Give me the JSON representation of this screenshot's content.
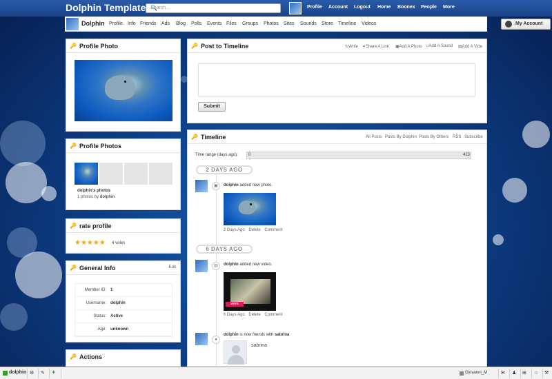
{
  "header": {
    "site_title": "Dolphin Template",
    "search_placeholder": "Search...",
    "nav": [
      "Profile",
      "Account",
      "Logout",
      "Home",
      "Boonex",
      "People",
      "More"
    ]
  },
  "profile_bar": {
    "name": "Dolphin",
    "nav": [
      "Profile",
      "Info",
      "Friends",
      "Ads",
      "Blog",
      "Polls",
      "Events",
      "Files",
      "Groups",
      "Photos",
      "Sites",
      "Sounds",
      "Store",
      "Timeline",
      "Videos"
    ],
    "my_account": "My Account"
  },
  "profile_photo": {
    "title": "Profile Photo"
  },
  "profile_photos": {
    "title": "Profile Photos",
    "album_title": "dolphin's photos",
    "album_meta_prefix": "1 photos by",
    "album_owner": "dolphin"
  },
  "rate_profile": {
    "title": "rate profile",
    "stars": 5,
    "votes": "4 votes"
  },
  "general_info": {
    "title": "General Info",
    "edit": "Edit",
    "rows": [
      {
        "label": "Member ID:",
        "value": "1"
      },
      {
        "label": "Username:",
        "value": "dolphin"
      },
      {
        "label": "Status:",
        "value": "Active"
      },
      {
        "label": "Age:",
        "value": "unknown"
      }
    ]
  },
  "actions": {
    "title": "Actions"
  },
  "post_timeline": {
    "title": "Post to Timeline",
    "tabs": [
      "Write",
      "Share A Link",
      "Add A Photo",
      "Add A Sound",
      "Add A Vide"
    ],
    "submit": "Submit"
  },
  "timeline": {
    "title": "Timeline",
    "filters": [
      "All Posts",
      "Posts By Dolphin",
      "Posts By Others",
      "RSS",
      "Subscribe"
    ],
    "range_label": "Time range (days ago):",
    "range_min": "0",
    "range_max": "423",
    "groups": [
      {
        "ago": "2 DAYS AGO",
        "event": {
          "user": "dolphin",
          "action": "added new photo.",
          "links": [
            "2 Days Ago",
            "Delete",
            "Comment"
          ]
        }
      },
      {
        "ago": "6 DAYS AGO",
        "event": {
          "user": "dolphin",
          "action": "added new video.",
          "links": [
            "6 Days Ago",
            "Delete",
            "Comment"
          ],
          "badge": "vevo"
        }
      }
    ],
    "friend_event": {
      "user": "dolphin",
      "action": "is now friends with",
      "friend": "sabrina"
    }
  },
  "bottom_bar": {
    "user": "dolphin",
    "right_user": "Giovanni_M"
  }
}
